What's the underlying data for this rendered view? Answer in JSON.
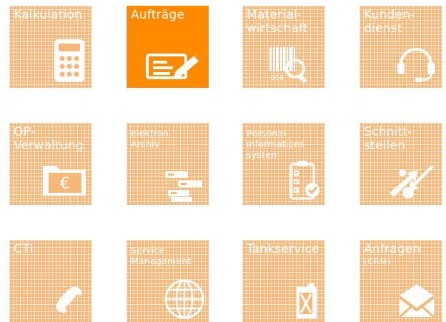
{
  "tiles": [
    {
      "title": "Kalkulation",
      "icon": "calculator-icon"
    },
    {
      "title": "Aufträge",
      "icon": "signature-icon"
    },
    {
      "title": "Material-\nwirtschaft",
      "icon": "barcode-search-icon",
      "icon_text": "016"
    },
    {
      "title": "Kunden-\ndienst",
      "icon": "headset-icon"
    },
    {
      "title": "OP-\nVerwaltung",
      "icon": "euro-folder-icon",
      "icon_text": "€"
    },
    {
      "title": "elektron.\nArchiv",
      "icon": "archive-drawers-icon"
    },
    {
      "title": "Personal-\ninformations-\nsystem",
      "icon": "clipboard-check-icon"
    },
    {
      "title": "Schnitt-\nstellen",
      "icon": "interface-arrows-icon"
    },
    {
      "title": "CTI",
      "icon": "phone-icon"
    },
    {
      "title": "Service-\nManagement",
      "icon": "globe-icon"
    },
    {
      "title": "Tankservice",
      "icon": "jerrycan-icon"
    },
    {
      "title": "Anfragen",
      "subtitle": "(CRM)",
      "icon": "envelope-icon"
    }
  ],
  "colors": {
    "tile": "#f6b878",
    "active_tile": "#ff8a00",
    "text": "#ffffff"
  }
}
